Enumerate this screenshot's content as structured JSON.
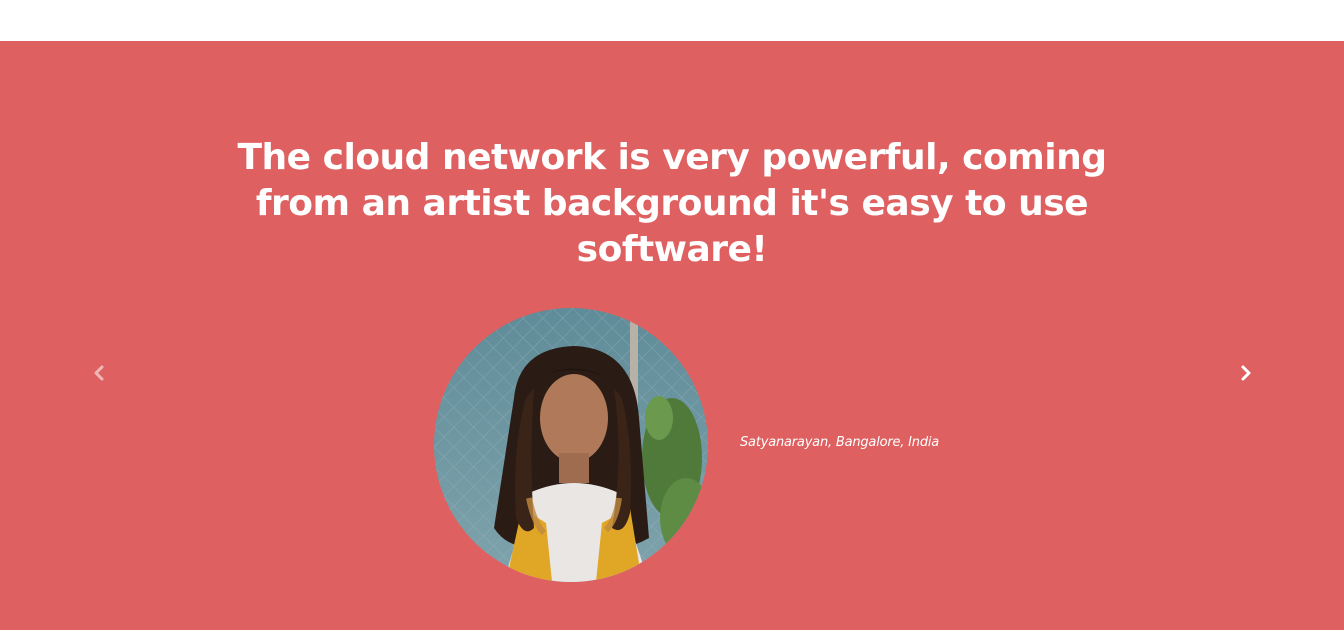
{
  "testimonial": {
    "quote": "The cloud network is very powerful, coming from an artist background it's easy to use software!",
    "author": "Satyanarayan, Bangalore, India",
    "avatar_icon": "person-photo",
    "background_color": "#df6060",
    "text_color": "#ffffff"
  },
  "carousel": {
    "prev_icon": "chevron-left-icon",
    "next_icon": "chevron-right-icon"
  }
}
